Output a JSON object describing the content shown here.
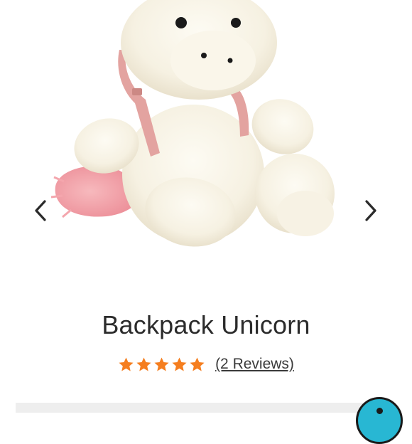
{
  "product": {
    "title": "Backpack Unicorn",
    "rating_value": 5,
    "rating_max": 5,
    "reviews_label": "(2 Reviews)"
  },
  "carousel": {
    "prev_icon": "chevron-left-icon",
    "next_icon": "chevron-right-icon"
  },
  "colors": {
    "star": "#f57e1f",
    "plush_body": "#f9f5ea",
    "backpack_strap": "#e3a3a0",
    "tail": "#f2a0a6",
    "chat_bubble": "#28b7d3"
  }
}
